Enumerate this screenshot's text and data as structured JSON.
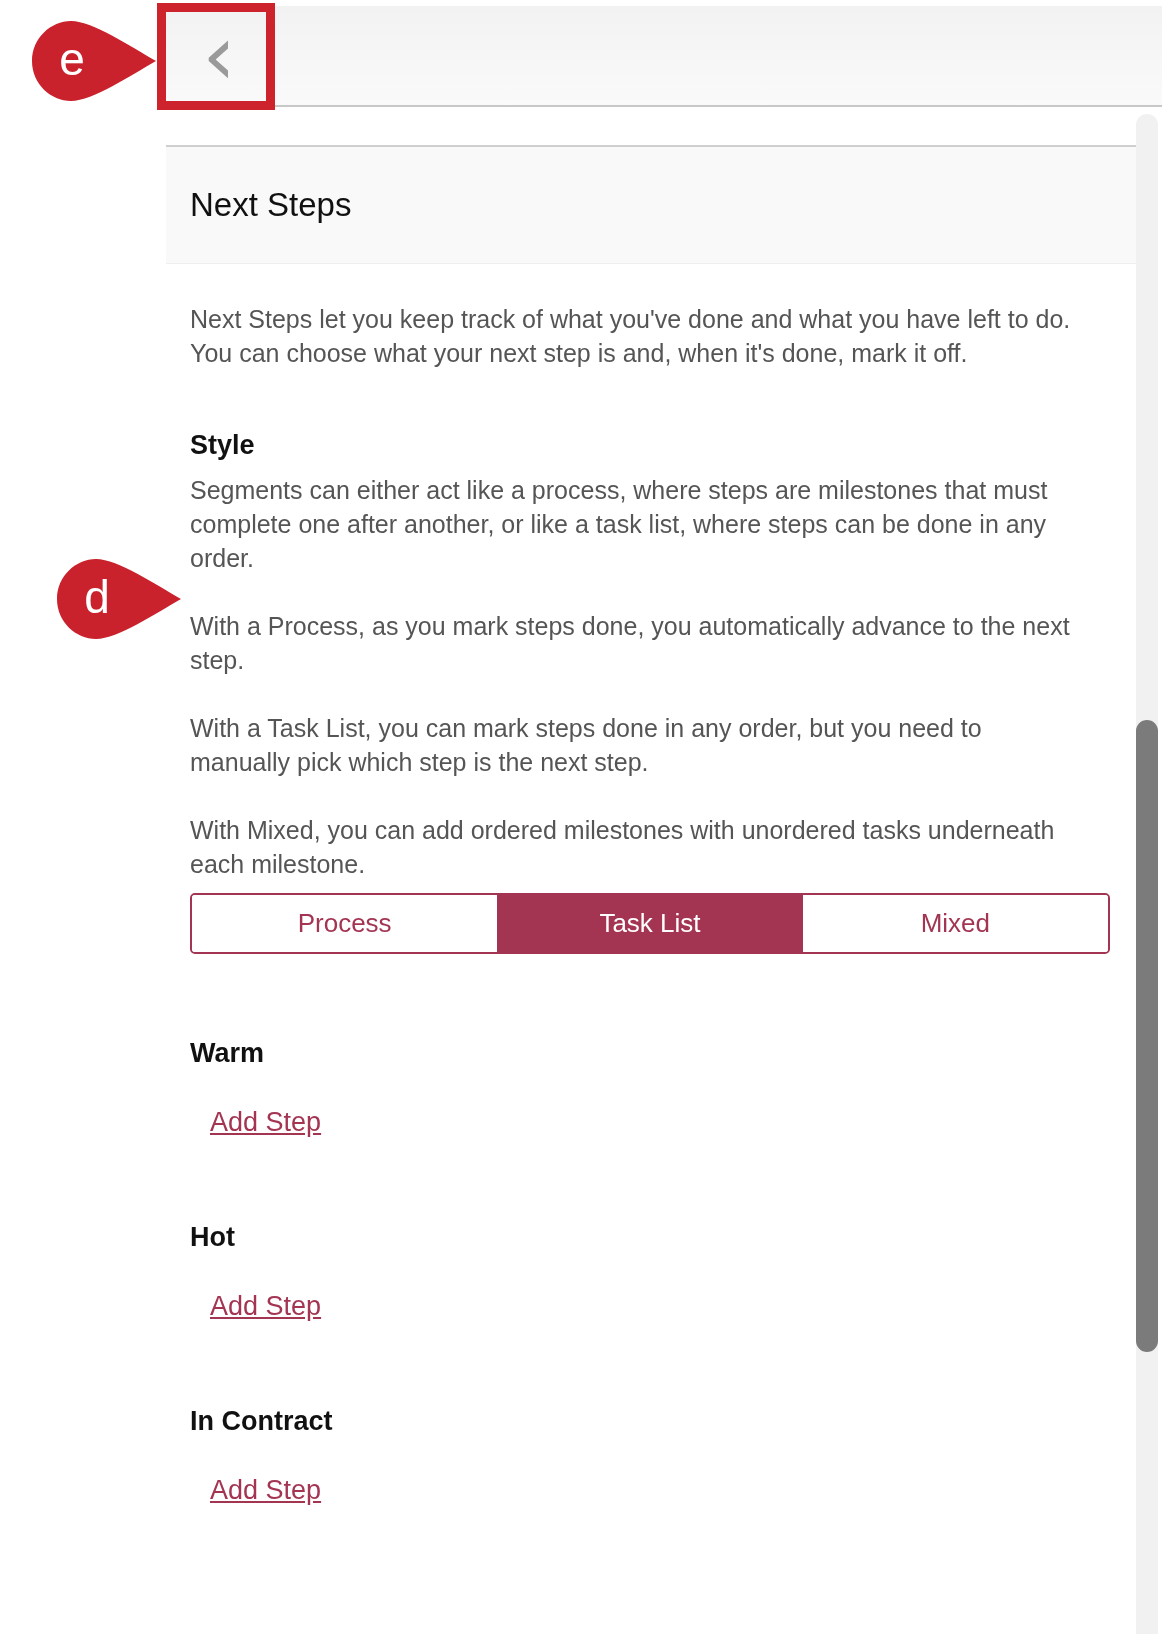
{
  "callouts": [
    {
      "label": "e"
    },
    {
      "label": "d"
    }
  ],
  "header": {
    "back_icon": "‹",
    "highlighted": true
  },
  "panel": {
    "title": "Next Steps",
    "intro": "Next Steps let you keep track of what you've done and what you have left to do. You can choose what your next step is and, when it's done, mark it off.",
    "style": {
      "heading": "Style",
      "paragraphs": [
        "Segments can either act like a process, where steps are milestones that must complete one after another, or like a task list, where steps can be done in any order.",
        "With a Process, as you mark steps done, you automatically advance to the next step.",
        "With a Task List, you can mark steps done in any order, but you need to manually pick which step is the next step.",
        "With Mixed, you can add ordered milestones with unordered tasks underneath each milestone."
      ],
      "options": [
        {
          "label": "Process",
          "selected": false
        },
        {
          "label": "Task List",
          "selected": true
        },
        {
          "label": "Mixed",
          "selected": false
        }
      ]
    },
    "segments": [
      {
        "name": "Warm",
        "link": "Add Step"
      },
      {
        "name": "Hot",
        "link": "Add Step"
      },
      {
        "name": "In Contract",
        "link": "Add Step"
      }
    ]
  }
}
